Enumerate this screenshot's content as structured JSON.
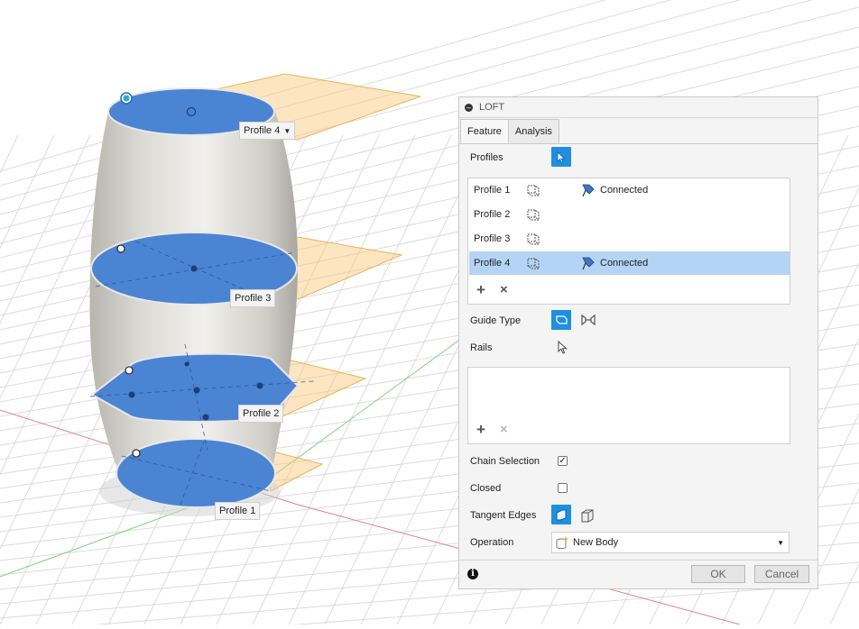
{
  "viewport": {
    "profile_labels": [
      {
        "label": "Profile 4",
        "has_dropdown": true
      },
      {
        "label": "Profile 3"
      },
      {
        "label": "Profile 2"
      },
      {
        "label": "Profile 1"
      }
    ]
  },
  "dialog": {
    "title": "LOFT",
    "tabs": [
      {
        "label": "Feature",
        "active": true
      },
      {
        "label": "Analysis",
        "active": false
      }
    ],
    "profiles_label": "Profiles",
    "profiles": [
      {
        "name": "Profile 1",
        "status": "Connected",
        "selected": false
      },
      {
        "name": "Profile 2",
        "status": "",
        "selected": false
      },
      {
        "name": "Profile 3",
        "status": "",
        "selected": false
      },
      {
        "name": "Profile 4",
        "status": "Connected",
        "selected": true
      }
    ],
    "add_symbol": "+",
    "remove_symbol": "×",
    "guide_type_label": "Guide Type",
    "rails_label": "Rails",
    "chain_selection_label": "Chain Selection",
    "chain_selection_checked": true,
    "closed_label": "Closed",
    "closed_checked": false,
    "tangent_edges_label": "Tangent Edges",
    "operation_label": "Operation",
    "operation_value": "New Body",
    "ok_label": "OK",
    "cancel_label": "Cancel",
    "accent_color": "#1f8fe0",
    "selection_color": "#b4d4f6"
  }
}
